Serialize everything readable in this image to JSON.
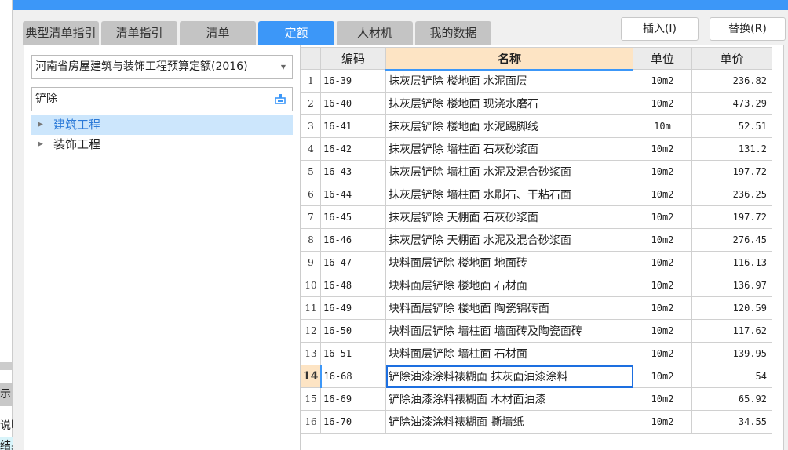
{
  "background_app": {
    "fragments": [
      "示",
      "说明",
      "结果"
    ]
  },
  "tabs": [
    {
      "label": "典型清单指引",
      "active": false
    },
    {
      "label": "清单指引",
      "active": false
    },
    {
      "label": "清单",
      "active": false
    },
    {
      "label": "定额",
      "active": true
    },
    {
      "label": "人材机",
      "active": false
    },
    {
      "label": "我的数据",
      "active": false
    }
  ],
  "buttons": {
    "insert": "插入(I)",
    "replace": "替换(R)"
  },
  "left": {
    "quota_library": "河南省房屋建筑与装饰工程预算定额(2016)",
    "search_value": "铲除",
    "tree": [
      {
        "label": "建筑工程",
        "selected": true
      },
      {
        "label": "装饰工程",
        "selected": false
      }
    ]
  },
  "grid": {
    "headers": [
      "",
      "编码",
      "名称",
      "单位",
      "单价"
    ],
    "current_row": 14,
    "rows": [
      {
        "n": "1",
        "code": "16-39",
        "name": "抹灰层铲除 楼地面 水泥面层",
        "unit": "10m2",
        "price": "236.82"
      },
      {
        "n": "2",
        "code": "16-40",
        "name": "抹灰层铲除 楼地面 现浇水磨石",
        "unit": "10m2",
        "price": "473.29"
      },
      {
        "n": "3",
        "code": "16-41",
        "name": "抹灰层铲除 楼地面 水泥踢脚线",
        "unit": "10m",
        "price": "52.51"
      },
      {
        "n": "4",
        "code": "16-42",
        "name": "抹灰层铲除 墙柱面 石灰砂浆面",
        "unit": "10m2",
        "price": "131.2"
      },
      {
        "n": "5",
        "code": "16-43",
        "name": "抹灰层铲除 墙柱面 水泥及混合砂浆面",
        "unit": "10m2",
        "price": "197.72"
      },
      {
        "n": "6",
        "code": "16-44",
        "name": "抹灰层铲除 墙柱面 水刷石、干粘石面",
        "unit": "10m2",
        "price": "236.25"
      },
      {
        "n": "7",
        "code": "16-45",
        "name": "抹灰层铲除 天棚面 石灰砂浆面",
        "unit": "10m2",
        "price": "197.72"
      },
      {
        "n": "8",
        "code": "16-46",
        "name": "抹灰层铲除 天棚面 水泥及混合砂浆面",
        "unit": "10m2",
        "price": "276.45"
      },
      {
        "n": "9",
        "code": "16-47",
        "name": "块料面层铲除 楼地面 地面砖",
        "unit": "10m2",
        "price": "116.13"
      },
      {
        "n": "10",
        "code": "16-48",
        "name": "块料面层铲除 楼地面 石材面",
        "unit": "10m2",
        "price": "136.97"
      },
      {
        "n": "11",
        "code": "16-49",
        "name": "块料面层铲除 楼地面 陶瓷锦砖面",
        "unit": "10m2",
        "price": "120.59"
      },
      {
        "n": "12",
        "code": "16-50",
        "name": "块料面层铲除 墙柱面 墙面砖及陶瓷面砖",
        "unit": "10m2",
        "price": "117.62"
      },
      {
        "n": "13",
        "code": "16-51",
        "name": "块料面层铲除 墙柱面 石材面",
        "unit": "10m2",
        "price": "139.95"
      },
      {
        "n": "14",
        "code": "16-68",
        "name": "铲除油漆涂料裱糊面 抹灰面油漆涂料",
        "unit": "10m2",
        "price": "54"
      },
      {
        "n": "15",
        "code": "16-69",
        "name": "铲除油漆涂料裱糊面 木材面油漆",
        "unit": "10m2",
        "price": "65.92"
      },
      {
        "n": "16",
        "code": "16-70",
        "name": "铲除油漆涂料裱糊面 撕墙纸",
        "unit": "10m2",
        "price": "34.55"
      }
    ]
  }
}
